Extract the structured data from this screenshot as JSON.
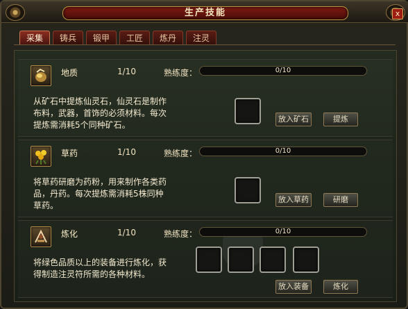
{
  "window": {
    "title": "生产技能",
    "close_label": "x"
  },
  "tabs": [
    "采集",
    "铸兵",
    "锻甲",
    "工匠",
    "炼丹",
    "注灵"
  ],
  "active_tab": 0,
  "sections": [
    {
      "name": "地质",
      "level": "1/10",
      "proficiency_label": "熟练度：",
      "progress_text": "0/10",
      "progress_fraction": 0,
      "desc_lines": [
        "从矿石中提炼仙灵石，仙灵石是制作",
        "布料，武器，首饰的必须材料。每次",
        "提炼需消耗5个同种矿石。"
      ],
      "button_put": "放入矿石",
      "button_action": "提炼",
      "icon": "ore-icon"
    },
    {
      "name": "草药",
      "level": "1/10",
      "proficiency_label": "熟练度：",
      "progress_text": "0/10",
      "progress_fraction": 0,
      "desc_lines": [
        "将草药研磨为药粉，用来制作各类药",
        "品，丹药。每次提炼需消耗5株同种",
        "草药。"
      ],
      "button_put": "放入草药",
      "button_action": "研磨",
      "icon": "herb-icon"
    },
    {
      "name": "炼化",
      "level": "1/10",
      "proficiency_label": "熟练度：",
      "progress_text": "0/10",
      "progress_fraction": 0,
      "desc_lines": [
        "将绿色品质以上的装备进行炼化，获",
        "得制造注灵符所需的各种材料。"
      ],
      "button_put": "放入装备",
      "button_action": "炼化",
      "icon": "refine-icon"
    }
  ]
}
